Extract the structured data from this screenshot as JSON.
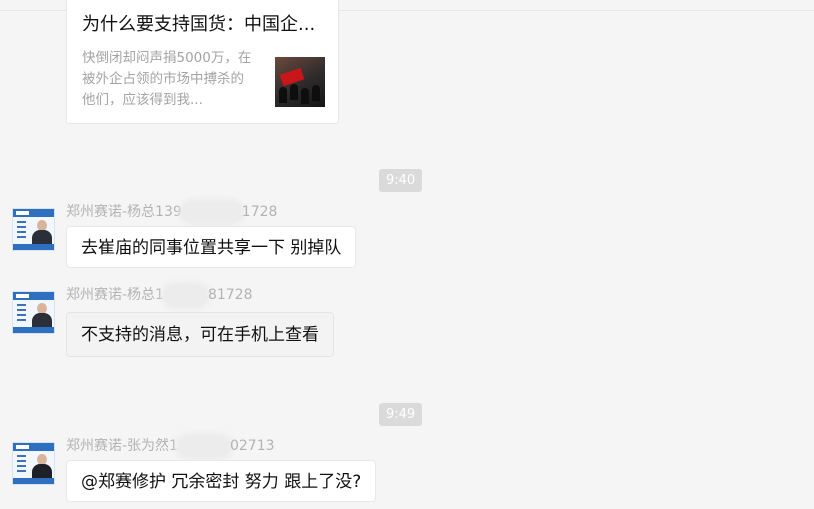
{
  "article_card": {
    "title": "为什么要支持国货：中国企...",
    "description": "快倒闭却闷声捐5000万，在被外企占领的市场中搏杀的他们，应该得到我...",
    "thumbnail": "flag-crowd-photo"
  },
  "messages": [
    {
      "timestamp": "9:40",
      "sender_prefix": "郑州赛诺-杨总139",
      "sender_suffix": "1728",
      "text": "去崔庙的同事位置共享一下  别掉队",
      "avatar": "business-card-avatar"
    },
    {
      "sender_prefix": "郑州赛诺-杨总1",
      "sender_suffix": "81728",
      "text": "不支持的消息，可在手机上查看",
      "avatar": "business-card-avatar"
    },
    {
      "timestamp": "9:49",
      "sender_prefix": "郑州赛诺-张为然1",
      "sender_suffix": "02713",
      "text": "@郑赛修护 冗余密封 努力 跟上了没?",
      "avatar": "business-card-avatar"
    }
  ],
  "colors": {
    "background": "#f5f5f5",
    "bubble": "#ffffff",
    "timestamp_bg": "#dadada",
    "sender_text": "#b3b3b3"
  }
}
